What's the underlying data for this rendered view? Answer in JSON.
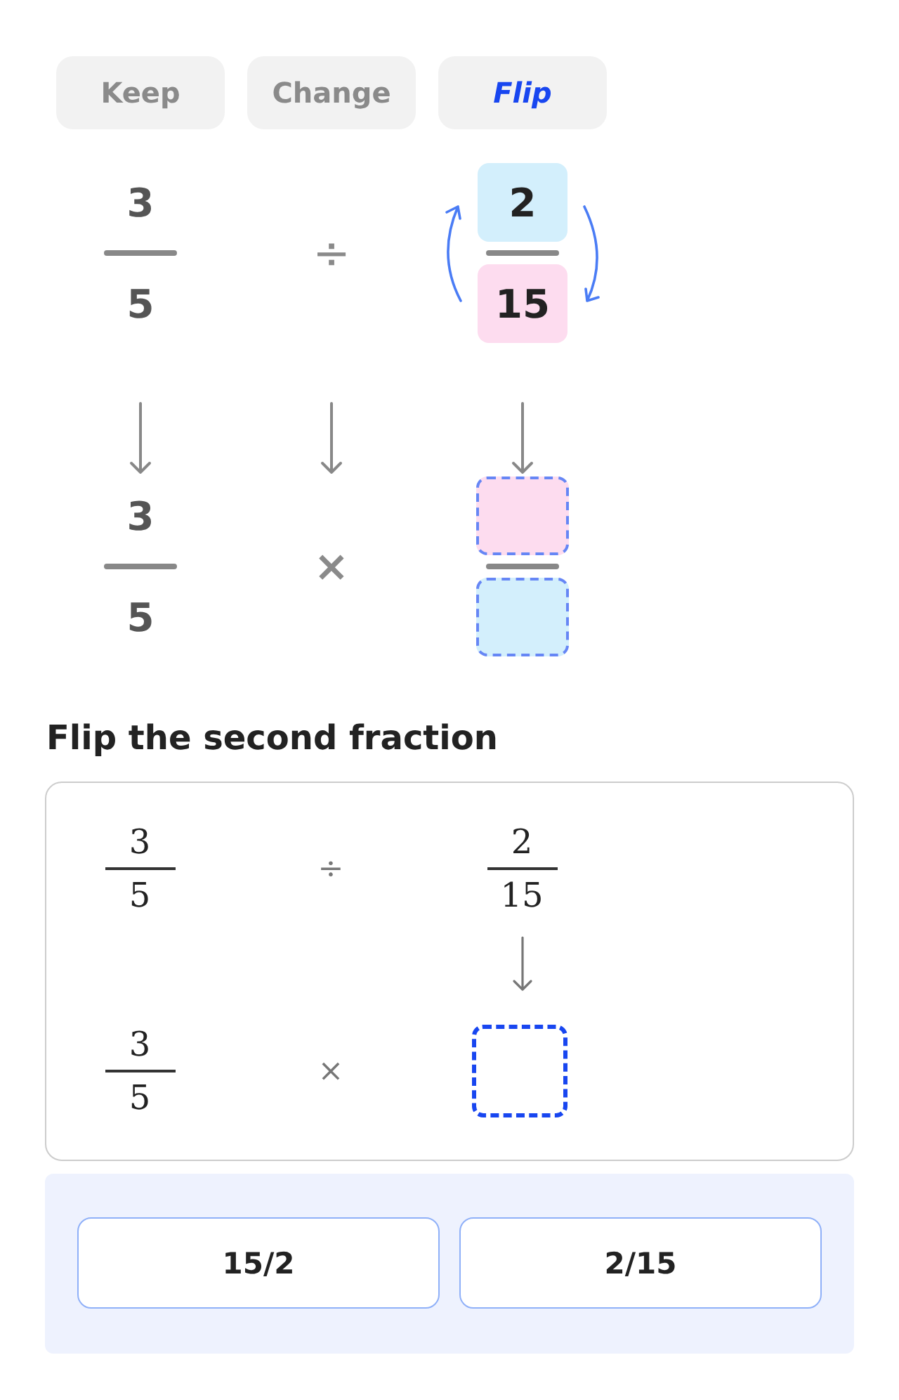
{
  "steps": [
    {
      "label": "Keep",
      "selected": false
    },
    {
      "label": "Change",
      "selected": false
    },
    {
      "label": "Flip",
      "selected": true
    }
  ],
  "diagram": {
    "before": {
      "first": {
        "numerator": "3",
        "denominator": "5"
      },
      "operator": "÷",
      "second": {
        "numerator": "2",
        "denominator": "15"
      }
    },
    "after": {
      "first": {
        "numerator": "3",
        "denominator": "5"
      },
      "operator": "×"
    }
  },
  "question": {
    "prompt": "Flip the second fraction",
    "before": {
      "first": {
        "numerator": "3",
        "denominator": "5"
      },
      "operator": "÷",
      "second": {
        "numerator": "2",
        "denominator": "15"
      }
    },
    "after": {
      "first": {
        "numerator": "3",
        "denominator": "5"
      },
      "operator": "×"
    }
  },
  "choices": [
    {
      "label": "15/2",
      "selected": false
    },
    {
      "label": "2/15",
      "selected": false
    }
  ]
}
